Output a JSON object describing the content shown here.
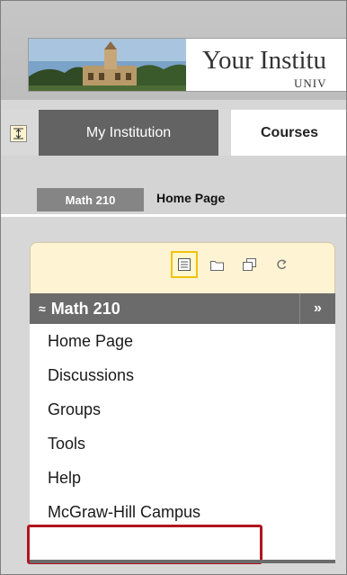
{
  "header": {
    "institution_name": "Your Institu",
    "institution_sub": "UNIV"
  },
  "tabs": {
    "toggle_icon": "expand-collapse-icon",
    "my_institution": "My Institution",
    "courses": "Courses"
  },
  "breadcrumb": {
    "course": "Math 210",
    "page": "Home Page"
  },
  "course_menu": {
    "tool_icons": [
      "list-view-icon",
      "folder-view-icon",
      "window-icon",
      "refresh-icon"
    ],
    "title": "Math 210",
    "collapse_glyph": "≈",
    "expand_glyph": "»",
    "items": [
      {
        "label": "Home Page"
      },
      {
        "label": "Discussions"
      },
      {
        "label": "Groups"
      },
      {
        "label": "Tools"
      },
      {
        "label": "Help"
      },
      {
        "label": "McGraw-Hill Campus"
      }
    ]
  },
  "colors": {
    "highlight": "#b0151d",
    "menu_header": "#6b6b6b",
    "panel_bg": "#fef4d4"
  }
}
